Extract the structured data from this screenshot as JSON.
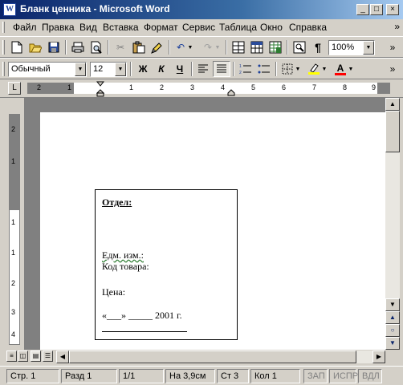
{
  "window": {
    "title": "Бланк ценника - Microsoft Word",
    "app_icon": "W"
  },
  "menu": {
    "items": [
      "Файл",
      "Правка",
      "Вид",
      "Вставка",
      "Формат",
      "Сервис",
      "Таблица",
      "Окно",
      "Справка"
    ]
  },
  "formatting": {
    "style": "Обычный",
    "size": "12",
    "zoom": "100%",
    "bold": "Ж",
    "italic": "К",
    "underline": "Ч"
  },
  "ruler": {
    "numbers": [
      "2",
      "1",
      "1",
      "2",
      "3",
      "4",
      "5",
      "6",
      "7",
      "8",
      "9"
    ],
    "v_numbers": [
      "2",
      "1",
      "1",
      "1",
      "2",
      "3",
      "4"
    ]
  },
  "document": {
    "otdel": "Отдел:",
    "edm": "Едм. изм.:",
    "kod": "Код товара:",
    "cena": "Цена:",
    "date": "«___» _____ 2001 г."
  },
  "status": {
    "page": "Стр. 1",
    "section": "Разд 1",
    "pages": "1/1",
    "at": "На 3,9см",
    "line": "Ст 3",
    "col": "Кол 1",
    "rec": "ЗАП",
    "trk": "ИСПР",
    "ext": "ВДЛ"
  },
  "colors": {
    "highlight": "#ffff00",
    "font_color": "#ff0000",
    "title_start": "#0a246a"
  }
}
